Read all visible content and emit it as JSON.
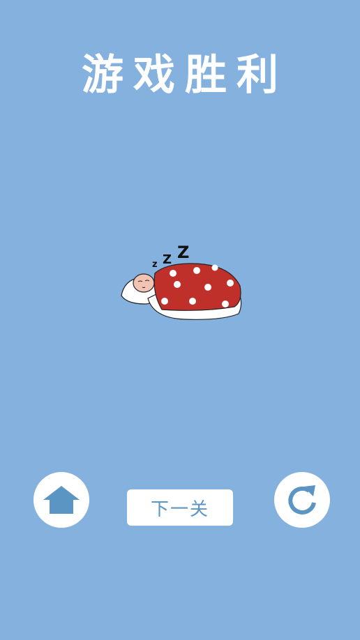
{
  "title": "游戏胜利",
  "next_button_label": "下一关",
  "icons": {
    "home": "home-icon",
    "restart": "restart-icon",
    "illustration": "sleeping-character-illustration"
  },
  "snore_text": [
    "z",
    "Z",
    "Z"
  ],
  "colors": {
    "background": "#84b1de",
    "icon_blue": "#5a95c4",
    "blanket_red": "#c0302a",
    "white": "#ffffff"
  }
}
